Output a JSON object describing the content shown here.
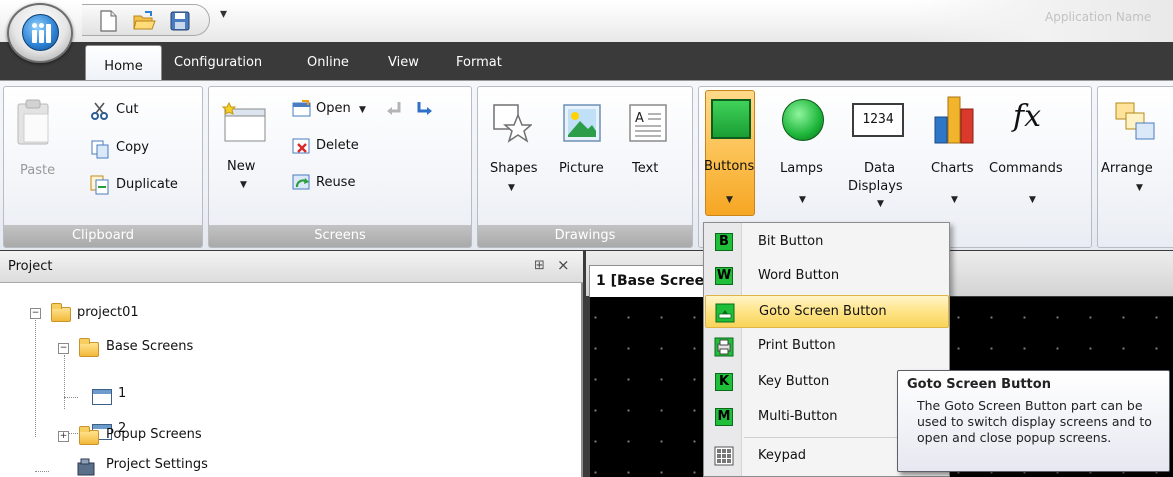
{
  "window": {
    "title": "Application Name"
  },
  "tabs": [
    {
      "label": "Home",
      "active": true
    },
    {
      "label": "Configuration"
    },
    {
      "label": "Online"
    },
    {
      "label": "View"
    },
    {
      "label": "Format"
    }
  ],
  "ribbon": {
    "clipboard": {
      "label": "Clipboard",
      "paste": "Paste",
      "cut": "Cut",
      "copy": "Copy",
      "duplicate": "Duplicate"
    },
    "screens": {
      "label": "Screens",
      "new": "New",
      "open": "Open",
      "delete": "Delete",
      "reuse": "Reuse"
    },
    "drawings": {
      "label": "Drawings",
      "shapes": "Shapes",
      "picture": "Picture",
      "text": "Text"
    },
    "parts": {
      "buttons": "Buttons",
      "lamps": "Lamps",
      "data_displays_line1": "Data",
      "data_displays_line2": "Displays",
      "data_display_icon_text": "1234",
      "charts": "Charts",
      "commands": "Commands",
      "commands_icon_text": "fx"
    },
    "arrange": {
      "label": "Arrange"
    }
  },
  "project_panel": {
    "title": "Project",
    "tree": {
      "root": "project01",
      "base_screens": "Base Screens",
      "screen1": "1",
      "screen2": "2",
      "popup_screens": "Popup Screens",
      "project_settings": "Project Settings"
    }
  },
  "editor": {
    "tab_label": "1 [Base Screen]"
  },
  "buttons_menu": {
    "items": [
      {
        "label": "Bit Button",
        "icon_text": "B"
      },
      {
        "label": "Word Button",
        "icon_text": "W"
      },
      {
        "label": "Goto Screen Button",
        "highlighted": true
      },
      {
        "label": "Print Button"
      },
      {
        "label": "Key Button",
        "icon_text": "K"
      },
      {
        "label": "Multi-Button",
        "icon_text": "M"
      },
      {
        "label": "Keypad"
      }
    ]
  },
  "tooltip": {
    "title": "Goto Screen Button",
    "body": "The Goto Screen Button part can be used to switch display screens and to open and close popup screens."
  },
  "colors": {
    "accent_orange": "#f6a623",
    "lamp_green": "#1db53a",
    "menu_highlight": "#ffe487"
  }
}
